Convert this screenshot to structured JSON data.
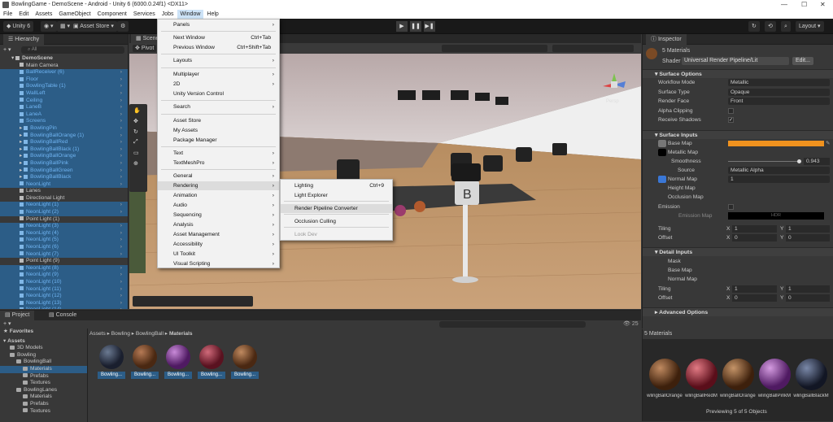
{
  "window": {
    "title": "BowlingGame - DemoScene - Android - Unity 6 (6000.0.24f1) <DX11>"
  },
  "menubar": [
    "File",
    "Edit",
    "Assets",
    "GameObject",
    "Component",
    "Services",
    "Jobs",
    "Window",
    "Help"
  ],
  "toolbar": {
    "account": "Unity 6",
    "asset_store": "Asset Store",
    "layout": "Layout"
  },
  "hierarchy": {
    "tab": "Hierarchy",
    "search_placeholder": "All",
    "scene": "DemoScene",
    "items": [
      "Main Camera",
      "BallReceiver (6)",
      "Floor",
      "BowlingTable (1)",
      "WallLeft",
      "Ceiling",
      "LaneB",
      "LaneA",
      "Screens",
      "BowlingPin",
      "BowlingBallOrange (1)",
      "BowlingBallRed",
      "BowlingBallBlack (1)",
      "BowlingBallOrange",
      "BowlingBallPink",
      "BowlingBallGreen",
      "BowlingBallBlack",
      "NeonLight",
      "Lanes",
      "Directional Light",
      "NeonLight (1)",
      "NeonLight (2)",
      "Point Light (1)",
      "NeonLight (3)",
      "NeonLight (4)",
      "NeonLight (5)",
      "NeonLight (6)",
      "NeonLight (7)",
      "Point Light (9)",
      "NeonLight (8)",
      "NeonLight (9)",
      "NeonLight (10)",
      "NeonLight (11)",
      "NeonLight (12)",
      "NeonLight (13)",
      "NeonLight (14)"
    ]
  },
  "scene": {
    "tab": "Scene",
    "pivot": "Pivot",
    "persp": "Persp"
  },
  "window_menu": {
    "items": [
      {
        "label": "Panels",
        "arrow": true
      },
      {
        "label": "Next Window",
        "shortcut": "Ctrl+Tab"
      },
      {
        "label": "Previous Window",
        "shortcut": "Ctrl+Shift+Tab"
      },
      {
        "label": "Layouts",
        "arrow": true
      },
      {
        "label": "Multiplayer",
        "arrow": true
      },
      {
        "label": "2D",
        "arrow": true
      },
      {
        "label": "Unity Version Control"
      },
      {
        "label": "Search",
        "arrow": true
      },
      {
        "label": "Asset Store"
      },
      {
        "label": "My Assets"
      },
      {
        "label": "Package Manager"
      },
      {
        "label": "Text",
        "arrow": true
      },
      {
        "label": "TextMeshPro",
        "arrow": true
      },
      {
        "label": "General",
        "arrow": true
      },
      {
        "label": "Rendering",
        "arrow": true
      },
      {
        "label": "Animation",
        "arrow": true
      },
      {
        "label": "Audio",
        "arrow": true
      },
      {
        "label": "Sequencing",
        "arrow": true
      },
      {
        "label": "Analysis",
        "arrow": true
      },
      {
        "label": "Asset Management",
        "arrow": true
      },
      {
        "label": "Accessibility",
        "arrow": true
      },
      {
        "label": "UI Toolkit",
        "arrow": true
      },
      {
        "label": "Visual Scripting",
        "arrow": true
      }
    ],
    "rendering_submenu": [
      {
        "label": "Lighting",
        "shortcut": "Ctrl+9"
      },
      {
        "label": "Light Explorer"
      },
      {
        "label": "Render Pipeline Converter"
      },
      {
        "label": "Occlusion Culling"
      },
      {
        "label": "Look Dev"
      }
    ]
  },
  "inspector": {
    "tab": "Inspector",
    "title": "5 Materials",
    "shader_label": "Shader",
    "shader_value": "Universal Render Pipeline/Lit",
    "edit_button": "Edit...",
    "surface_options": {
      "header": "Surface Options",
      "rows": [
        [
          "Workflow Mode",
          "Metallic"
        ],
        [
          "Surface Type",
          "Opaque"
        ],
        [
          "Render Face",
          "Front"
        ],
        [
          "Alpha Clipping",
          ""
        ],
        [
          "Receive Shadows",
          "✓"
        ]
      ]
    },
    "surface_inputs": {
      "header": "Surface Inputs",
      "base_map": "Base Map",
      "metallic_map": "Metallic Map",
      "smoothness": "Smoothness",
      "smoothness_value": "0.943",
      "source": "Source",
      "source_value": "Metallic Alpha",
      "normal_map": "Normal Map",
      "normal_value": "1",
      "height_map": "Height Map",
      "occlusion_map": "Occlusion Map",
      "emission": "Emission",
      "emission_map": "Emission Map",
      "hdr": "HDR",
      "tiling": "Tiling",
      "offset": "Offset"
    },
    "detail_inputs": {
      "header": "Detail Inputs",
      "mask": "Mask",
      "base_map": "Base Map",
      "normal_map": "Normal Map",
      "tiling": "Tiling",
      "offset": "Offset"
    },
    "advanced": "Advanced Options",
    "xy": {
      "x": "X",
      "y": "Y",
      "one": "1",
      "zero": "0"
    },
    "accent": "#f0921e"
  },
  "project": {
    "tabs": [
      "Project",
      "Console"
    ],
    "breadcrumb": [
      "Assets",
      "Bowling",
      "BowlingBall",
      "Materials"
    ],
    "count": "25",
    "tree": [
      {
        "label": "Favorites",
        "indent": 0,
        "bold": true
      },
      {
        "label": "Assets",
        "indent": 0,
        "bold": true
      },
      {
        "label": "3D Models",
        "indent": 1
      },
      {
        "label": "Bowling",
        "indent": 1
      },
      {
        "label": "BowlingBall",
        "indent": 2
      },
      {
        "label": "Materials",
        "indent": 3,
        "sel": true
      },
      {
        "label": "Prefabs",
        "indent": 3
      },
      {
        "label": "Textures",
        "indent": 3
      },
      {
        "label": "BowlingLanes",
        "indent": 2
      },
      {
        "label": "Materials",
        "indent": 3
      },
      {
        "label": "Prefabs",
        "indent": 3
      },
      {
        "label": "Textures",
        "indent": 3
      }
    ],
    "materials": [
      "Bowling...",
      "Bowling...",
      "Bowling...",
      "Bowling...",
      "Bowling..."
    ]
  },
  "preview": {
    "title": "5 Materials",
    "names": [
      "wlingBallOrange",
      "wlingBallRedM",
      "wlingBallOrangeM",
      "wlingBallPinkM",
      "wlingBallBlackM"
    ],
    "footer": "Previewing 5 of 5 Objects"
  }
}
